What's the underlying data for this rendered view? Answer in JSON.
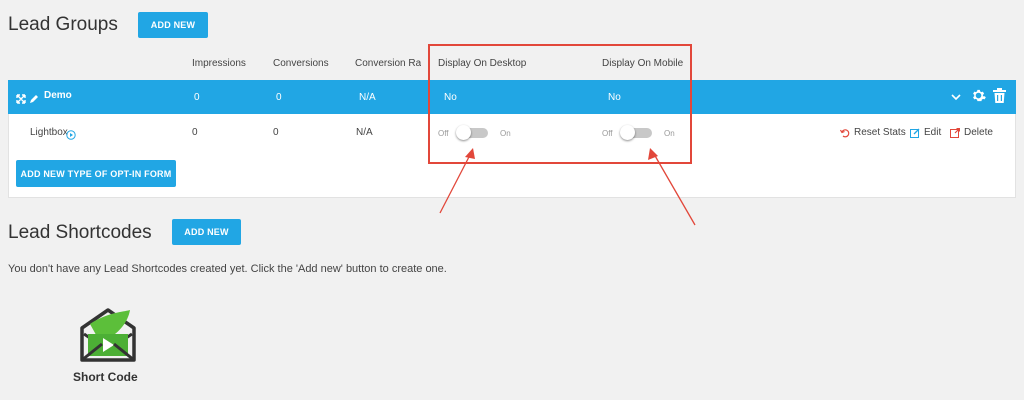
{
  "lead_groups": {
    "heading": "Lead Groups",
    "add_new_label": "ADD NEW",
    "columns": [
      "Impressions",
      "Conversions",
      "Conversion Ra...",
      "Display On Desktop",
      "Display On Mobile"
    ],
    "group": {
      "name": "Demo",
      "impressions": "0",
      "conversions": "0",
      "conversion_rate": "N/A",
      "display_desktop": "No",
      "display_mobile": "No"
    },
    "item": {
      "name": "Lightbox",
      "impressions": "0",
      "conversions": "0",
      "conversion_rate": "N/A",
      "toggle_off": "Off",
      "toggle_on": "On",
      "desktop_enabled": false,
      "mobile_enabled": false
    },
    "actions": {
      "reset_stats": "Reset Stats",
      "edit": "Edit",
      "delete": "Delete"
    },
    "add_type_label": "ADD NEW TYPE OF OPT-IN FORM"
  },
  "lead_shortcodes": {
    "heading": "Lead Shortcodes",
    "add_new_label": "ADD NEW",
    "empty_message": "You don't have any Lead Shortcodes created yet. Click the 'Add new' button to create one.",
    "icon_label": "Short Code"
  },
  "colors": {
    "accent": "#21a6e4",
    "annotation": "#e2473a",
    "icon_green": "#4caf35"
  }
}
